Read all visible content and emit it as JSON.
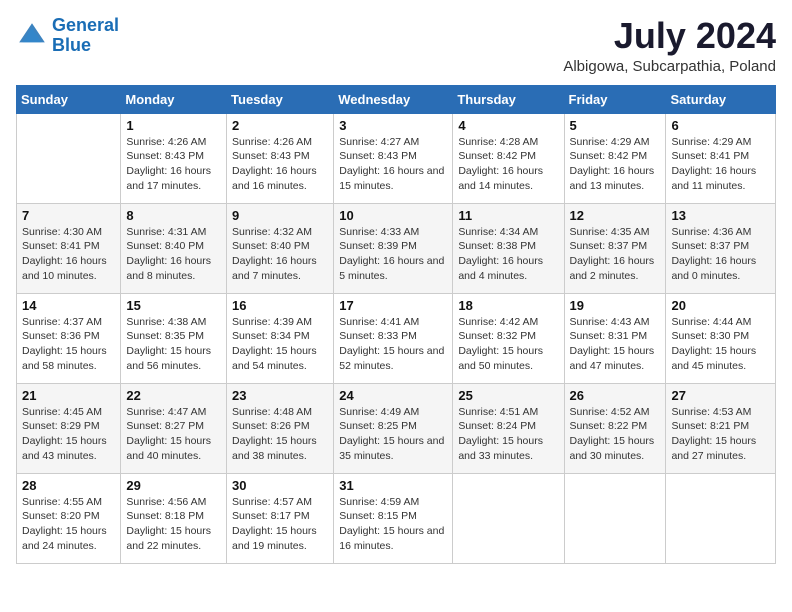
{
  "header": {
    "logo_line1": "General",
    "logo_line2": "Blue",
    "month_year": "July 2024",
    "location": "Albigowa, Subcarpathia, Poland"
  },
  "weekdays": [
    "Sunday",
    "Monday",
    "Tuesday",
    "Wednesday",
    "Thursday",
    "Friday",
    "Saturday"
  ],
  "weeks": [
    [
      {
        "day": null
      },
      {
        "day": "1",
        "sunrise": "Sunrise: 4:26 AM",
        "sunset": "Sunset: 8:43 PM",
        "daylight": "Daylight: 16 hours and 17 minutes."
      },
      {
        "day": "2",
        "sunrise": "Sunrise: 4:26 AM",
        "sunset": "Sunset: 8:43 PM",
        "daylight": "Daylight: 16 hours and 16 minutes."
      },
      {
        "day": "3",
        "sunrise": "Sunrise: 4:27 AM",
        "sunset": "Sunset: 8:43 PM",
        "daylight": "Daylight: 16 hours and 15 minutes."
      },
      {
        "day": "4",
        "sunrise": "Sunrise: 4:28 AM",
        "sunset": "Sunset: 8:42 PM",
        "daylight": "Daylight: 16 hours and 14 minutes."
      },
      {
        "day": "5",
        "sunrise": "Sunrise: 4:29 AM",
        "sunset": "Sunset: 8:42 PM",
        "daylight": "Daylight: 16 hours and 13 minutes."
      },
      {
        "day": "6",
        "sunrise": "Sunrise: 4:29 AM",
        "sunset": "Sunset: 8:41 PM",
        "daylight": "Daylight: 16 hours and 11 minutes."
      }
    ],
    [
      {
        "day": "7",
        "sunrise": "Sunrise: 4:30 AM",
        "sunset": "Sunset: 8:41 PM",
        "daylight": "Daylight: 16 hours and 10 minutes."
      },
      {
        "day": "8",
        "sunrise": "Sunrise: 4:31 AM",
        "sunset": "Sunset: 8:40 PM",
        "daylight": "Daylight: 16 hours and 8 minutes."
      },
      {
        "day": "9",
        "sunrise": "Sunrise: 4:32 AM",
        "sunset": "Sunset: 8:40 PM",
        "daylight": "Daylight: 16 hours and 7 minutes."
      },
      {
        "day": "10",
        "sunrise": "Sunrise: 4:33 AM",
        "sunset": "Sunset: 8:39 PM",
        "daylight": "Daylight: 16 hours and 5 minutes."
      },
      {
        "day": "11",
        "sunrise": "Sunrise: 4:34 AM",
        "sunset": "Sunset: 8:38 PM",
        "daylight": "Daylight: 16 hours and 4 minutes."
      },
      {
        "day": "12",
        "sunrise": "Sunrise: 4:35 AM",
        "sunset": "Sunset: 8:37 PM",
        "daylight": "Daylight: 16 hours and 2 minutes."
      },
      {
        "day": "13",
        "sunrise": "Sunrise: 4:36 AM",
        "sunset": "Sunset: 8:37 PM",
        "daylight": "Daylight: 16 hours and 0 minutes."
      }
    ],
    [
      {
        "day": "14",
        "sunrise": "Sunrise: 4:37 AM",
        "sunset": "Sunset: 8:36 PM",
        "daylight": "Daylight: 15 hours and 58 minutes."
      },
      {
        "day": "15",
        "sunrise": "Sunrise: 4:38 AM",
        "sunset": "Sunset: 8:35 PM",
        "daylight": "Daylight: 15 hours and 56 minutes."
      },
      {
        "day": "16",
        "sunrise": "Sunrise: 4:39 AM",
        "sunset": "Sunset: 8:34 PM",
        "daylight": "Daylight: 15 hours and 54 minutes."
      },
      {
        "day": "17",
        "sunrise": "Sunrise: 4:41 AM",
        "sunset": "Sunset: 8:33 PM",
        "daylight": "Daylight: 15 hours and 52 minutes."
      },
      {
        "day": "18",
        "sunrise": "Sunrise: 4:42 AM",
        "sunset": "Sunset: 8:32 PM",
        "daylight": "Daylight: 15 hours and 50 minutes."
      },
      {
        "day": "19",
        "sunrise": "Sunrise: 4:43 AM",
        "sunset": "Sunset: 8:31 PM",
        "daylight": "Daylight: 15 hours and 47 minutes."
      },
      {
        "day": "20",
        "sunrise": "Sunrise: 4:44 AM",
        "sunset": "Sunset: 8:30 PM",
        "daylight": "Daylight: 15 hours and 45 minutes."
      }
    ],
    [
      {
        "day": "21",
        "sunrise": "Sunrise: 4:45 AM",
        "sunset": "Sunset: 8:29 PM",
        "daylight": "Daylight: 15 hours and 43 minutes."
      },
      {
        "day": "22",
        "sunrise": "Sunrise: 4:47 AM",
        "sunset": "Sunset: 8:27 PM",
        "daylight": "Daylight: 15 hours and 40 minutes."
      },
      {
        "day": "23",
        "sunrise": "Sunrise: 4:48 AM",
        "sunset": "Sunset: 8:26 PM",
        "daylight": "Daylight: 15 hours and 38 minutes."
      },
      {
        "day": "24",
        "sunrise": "Sunrise: 4:49 AM",
        "sunset": "Sunset: 8:25 PM",
        "daylight": "Daylight: 15 hours and 35 minutes."
      },
      {
        "day": "25",
        "sunrise": "Sunrise: 4:51 AM",
        "sunset": "Sunset: 8:24 PM",
        "daylight": "Daylight: 15 hours and 33 minutes."
      },
      {
        "day": "26",
        "sunrise": "Sunrise: 4:52 AM",
        "sunset": "Sunset: 8:22 PM",
        "daylight": "Daylight: 15 hours and 30 minutes."
      },
      {
        "day": "27",
        "sunrise": "Sunrise: 4:53 AM",
        "sunset": "Sunset: 8:21 PM",
        "daylight": "Daylight: 15 hours and 27 minutes."
      }
    ],
    [
      {
        "day": "28",
        "sunrise": "Sunrise: 4:55 AM",
        "sunset": "Sunset: 8:20 PM",
        "daylight": "Daylight: 15 hours and 24 minutes."
      },
      {
        "day": "29",
        "sunrise": "Sunrise: 4:56 AM",
        "sunset": "Sunset: 8:18 PM",
        "daylight": "Daylight: 15 hours and 22 minutes."
      },
      {
        "day": "30",
        "sunrise": "Sunrise: 4:57 AM",
        "sunset": "Sunset: 8:17 PM",
        "daylight": "Daylight: 15 hours and 19 minutes."
      },
      {
        "day": "31",
        "sunrise": "Sunrise: 4:59 AM",
        "sunset": "Sunset: 8:15 PM",
        "daylight": "Daylight: 15 hours and 16 minutes."
      },
      {
        "day": null
      },
      {
        "day": null
      },
      {
        "day": null
      }
    ]
  ]
}
